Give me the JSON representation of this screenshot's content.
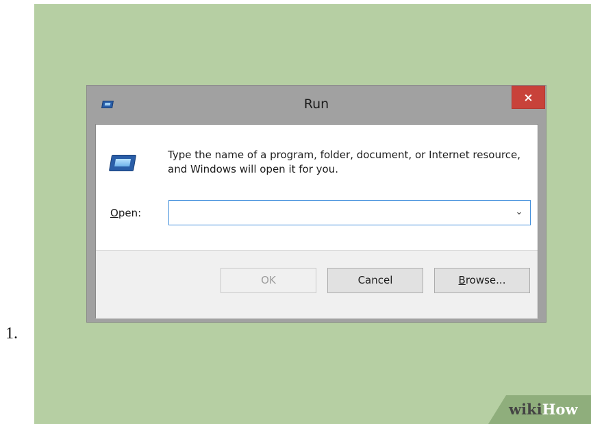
{
  "list_marker": "1.",
  "dialog": {
    "title": "Run",
    "close_glyph": "×",
    "instruction": "Type the name of a program, folder, document, or Internet resource, and Windows will open it for you.",
    "open_label_accel": "O",
    "open_label_rest": "pen:",
    "open_value": "",
    "dropdown_glyph": "⌄",
    "buttons": {
      "ok": "OK",
      "cancel": "Cancel",
      "browse_accel": "B",
      "browse_rest": "rowse..."
    }
  },
  "watermark": {
    "part1": "wiki",
    "part2": "How"
  },
  "icons": {
    "title_icon": "run-dialog-icon",
    "app_icon": "run-program-icon",
    "close": "close-icon",
    "dropdown": "chevron-down-icon"
  },
  "colors": {
    "background": "#b6cfa3",
    "close_button": "#c8423a",
    "input_border": "#3e8ddb"
  }
}
